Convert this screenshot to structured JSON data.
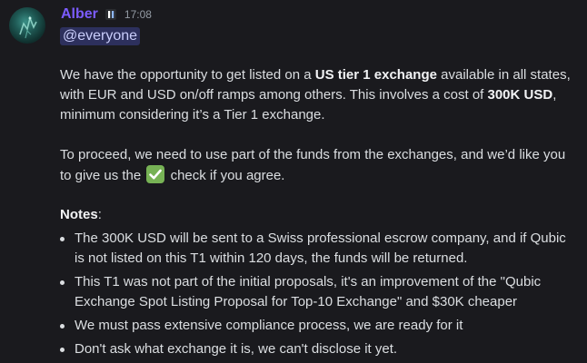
{
  "message": {
    "author": "Alber",
    "timestamp": "17:08",
    "mention": "@everyone",
    "para1": {
      "t1": "We have the opportunity to get listed on a ",
      "b1": "US tier 1 exchange",
      "t2": " available in all states, with EUR and USD on/off ramps among others. This involves a cost of ",
      "b2": "300K USD",
      "t3": ", minimum considering it’s a Tier 1 exchange."
    },
    "para2": {
      "t1": "To proceed, we need to use part of the funds from the exchanges, and we’d like you to give us the ",
      "emoji": "white-check-mark-emoji",
      "t2": " check if you agree."
    },
    "notes_label": "Notes",
    "notes_colon": ":",
    "notes": [
      "The 300K USD will be sent to a Swiss professional escrow company, and if Qubic is not listed on this T1 within 120 days, the funds will be returned.",
      "This T1 was not part of the initial proposals, it's an improvement of the \"Qubic Exchange Spot Listing Proposal for Top-10 Exchange\" and $30K cheaper",
      "We must pass extensive compliance process, we are ready for it",
      "Don't ask what exchange it is, we can't disclose it yet."
    ]
  },
  "colors": {
    "background": "#1a1a1e",
    "username": "#7c5cff",
    "mention_bg": "rgba(88,101,242,0.3)",
    "text": "#dbdee1",
    "timestamp": "#949ba4"
  }
}
